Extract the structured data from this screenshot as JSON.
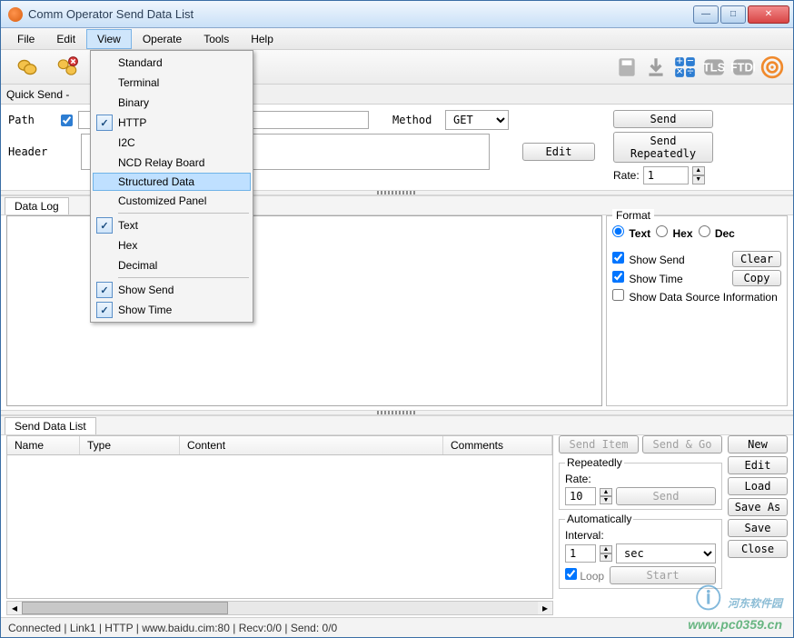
{
  "window": {
    "title": "Comm Operator    Send Data List"
  },
  "menu": {
    "file": "File",
    "edit": "Edit",
    "view": "View",
    "operate": "Operate",
    "tools": "Tools",
    "help": "Help"
  },
  "quick_send": "Quick Send -",
  "http": {
    "path_label": "Path",
    "path_value": "",
    "header_label": "Header",
    "header_value": "",
    "method_label": "Method",
    "method_value": "GET",
    "edit_btn": "Edit"
  },
  "right": {
    "send": "Send",
    "send_repeatedly": "Send Repeatedly",
    "rate_label": "Rate:",
    "rate_value": "1"
  },
  "data_log_tab": "Data Log",
  "format": {
    "title": "Format",
    "text": "Text",
    "hex": "Hex",
    "dec": "Dec",
    "show_send": "Show Send",
    "clear": "Clear",
    "show_time": "Show Time",
    "copy": "Copy",
    "show_dsi": "Show Data Source Information"
  },
  "send_list_tab": "Send Data List",
  "table": {
    "name": "Name",
    "type": "Type",
    "content": "Content",
    "comments": "Comments"
  },
  "sendpanel": {
    "send_item": "Send Item",
    "send_go": "Send & Go",
    "repeatedly": "Repeatedly",
    "rate_label": "Rate:",
    "rate_value": "10",
    "send": "Send",
    "automatically": "Automatically",
    "interval_label": "Interval:",
    "interval_value": "1",
    "interval_unit": "sec",
    "loop": "Loop",
    "start": "Start",
    "new": "New",
    "edit": "Edit",
    "load": "Load",
    "save_as": "Save As",
    "save": "Save",
    "close": "Close"
  },
  "status": "Connected | Link1 | HTTP | www.baidu.cim:80 | Recv:0/0 | Send: 0/0",
  "viewmenu": {
    "standard": "Standard",
    "terminal": "Terminal",
    "binary": "Binary",
    "http": "HTTP",
    "i2c": "I2C",
    "ncd": "NCD Relay Board",
    "structured": "Structured Data",
    "custom": "Customized Panel",
    "text": "Text",
    "hex": "Hex",
    "decimal": "Decimal",
    "show_send": "Show Send",
    "show_time": "Show Time"
  },
  "watermark": {
    "text": "河东软件园",
    "url": "www.pc0359.cn"
  }
}
